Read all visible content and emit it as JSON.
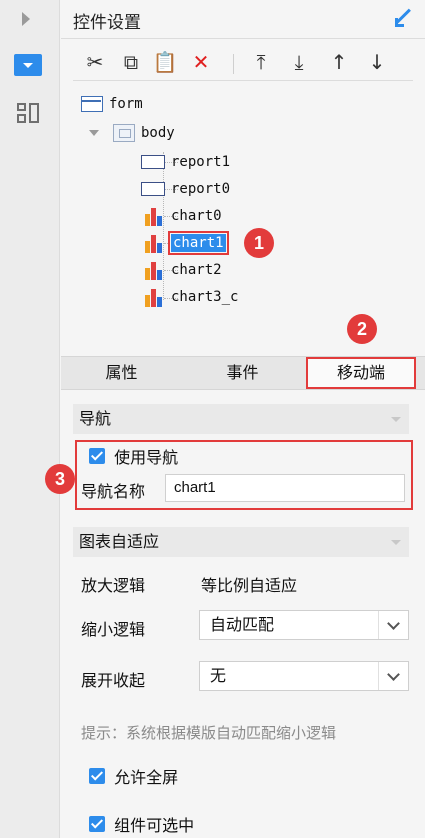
{
  "panel": {
    "title": "控件设置"
  },
  "toolbar": {
    "cut": "✂",
    "copy": "⧉",
    "paste": "📋",
    "delete": "✕",
    "move_top": "⤒",
    "move_bottom": "⤓",
    "move_up": "↑",
    "move_down": "↓"
  },
  "tree": {
    "form": "form",
    "body": "body",
    "children": [
      "report1",
      "report0",
      "chart0",
      "chart1",
      "chart2",
      "chart3_c"
    ],
    "selected": "chart1"
  },
  "badges": [
    "1",
    "2",
    "3"
  ],
  "tabs": [
    "属性",
    "事件",
    "移动端"
  ],
  "navigation": {
    "section_title": "导航",
    "use_nav_label": "使用导航",
    "use_nav_checked": true,
    "name_label": "导航名称",
    "name_value": "chart1"
  },
  "adaptive": {
    "section_title": "图表自适应",
    "zoom_in_label": "放大逻辑",
    "zoom_in_value": "等比例自适应",
    "zoom_out_label": "缩小逻辑",
    "zoom_out_value": "自动匹配",
    "expand_label": "展开收起",
    "expand_value": "无",
    "hint": "提示：系统根据模版自动匹配缩小逻辑"
  },
  "options": {
    "fullscreen_label": "允许全屏",
    "fullscreen_checked": true,
    "selectable_label": "组件可选中",
    "selectable_checked": true
  },
  "colors": {
    "accent": "#2d8ceb",
    "highlight": "#e23b3b"
  }
}
